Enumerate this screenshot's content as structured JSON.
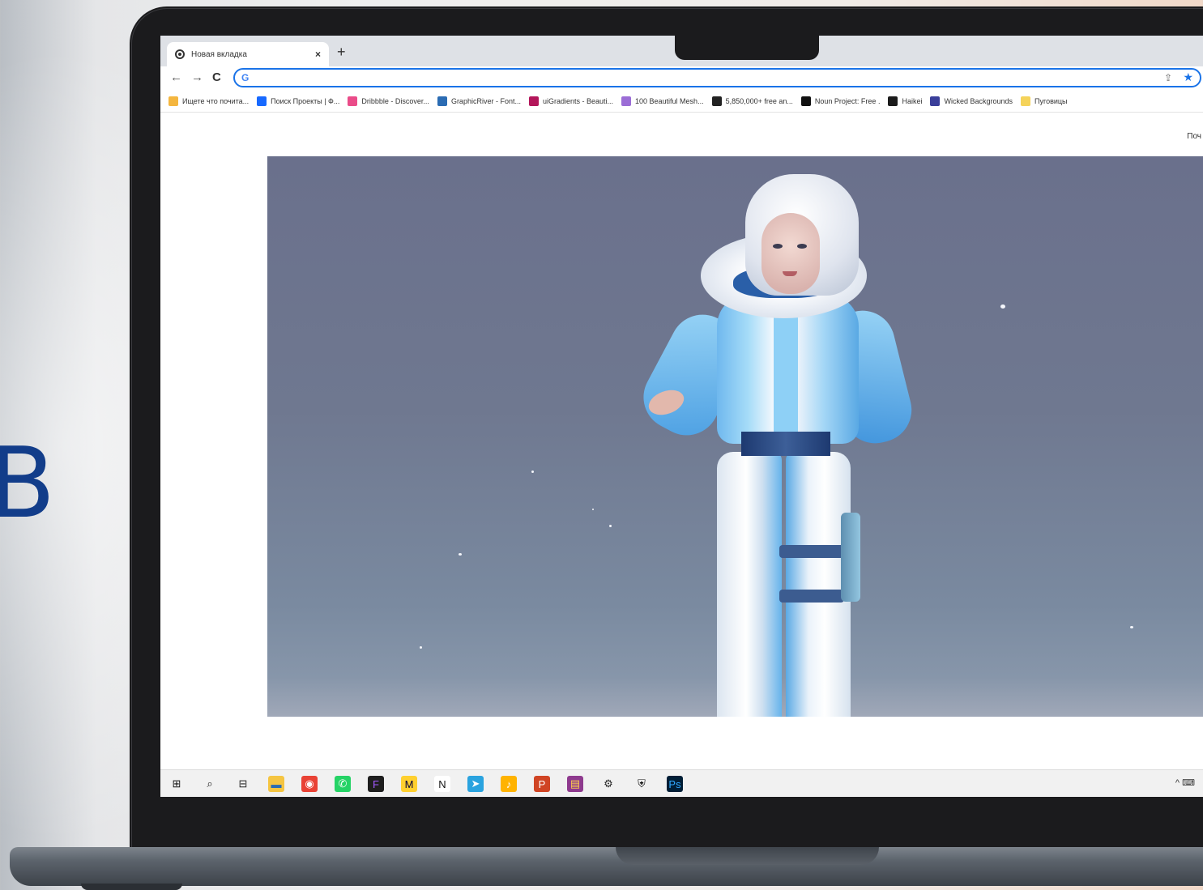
{
  "side_text": "В",
  "browser": {
    "tab": {
      "title": "Новая вкладка",
      "close": "×"
    },
    "new_tab": "+",
    "nav": {
      "back": "←",
      "forward": "→",
      "reload": "C"
    },
    "omnibox": {
      "value": "",
      "icon": "G"
    },
    "icons": {
      "share": "⇪",
      "bookmark": "★"
    },
    "bookmarks": [
      {
        "label": "Ищете что почита...",
        "color": "#f4b63f"
      },
      {
        "label": "Поиск Проекты | Ф...",
        "color": "#1769ff"
      },
      {
        "label": "Dribbble - Discover...",
        "color": "#ea4c89"
      },
      {
        "label": "GraphicRiver - Font...",
        "color": "#2b6cb3"
      },
      {
        "label": "uiGradients - Beauti...",
        "color": "#b3165a"
      },
      {
        "label": "100 Beautiful Mesh...",
        "color": "#9b6dd6"
      },
      {
        "label": "5,850,000+ free an...",
        "color": "#222222"
      },
      {
        "label": "Noun Project: Free .",
        "color": "#111111"
      },
      {
        "label": "Haikei",
        "color": "#1b1b1b"
      },
      {
        "label": "Wicked Backgrounds",
        "color": "#3a3f9a"
      },
      {
        "label": "Пуговицы",
        "color": "#f5d35a"
      }
    ],
    "page_link": "Поч"
  },
  "taskbar": {
    "icons": [
      {
        "name": "windows-start-icon",
        "glyph": "⊞",
        "bg": "transparent",
        "fg": "#111"
      },
      {
        "name": "search-icon",
        "glyph": "⌕",
        "bg": "transparent",
        "fg": "#222"
      },
      {
        "name": "task-view-icon",
        "glyph": "⊟",
        "bg": "transparent",
        "fg": "#222"
      },
      {
        "name": "file-explorer-icon",
        "glyph": "▬",
        "bg": "#f5c542",
        "fg": "#2b6cb3"
      },
      {
        "name": "chrome-icon",
        "glyph": "◉",
        "bg": "#e94235",
        "fg": "#fff"
      },
      {
        "name": "whatsapp-icon",
        "glyph": "✆",
        "bg": "#25d366",
        "fg": "#fff"
      },
      {
        "name": "figma-icon",
        "glyph": "F",
        "bg": "#1e1e1e",
        "fg": "#a259ff"
      },
      {
        "name": "miro-icon",
        "glyph": "M",
        "bg": "#ffd02f",
        "fg": "#050038"
      },
      {
        "name": "notion-icon",
        "glyph": "N",
        "bg": "#ffffff",
        "fg": "#111"
      },
      {
        "name": "telegram-icon",
        "glyph": "➤",
        "bg": "#2aa3df",
        "fg": "#fff"
      },
      {
        "name": "music-icon",
        "glyph": "♪",
        "bg": "#ffb300",
        "fg": "#fff"
      },
      {
        "name": "powerpoint-icon",
        "glyph": "P",
        "bg": "#d04423",
        "fg": "#fff"
      },
      {
        "name": "winrar-icon",
        "glyph": "▤",
        "bg": "#8e3a8e",
        "fg": "#ffd24a"
      },
      {
        "name": "settings-gear-icon",
        "glyph": "⚙",
        "bg": "transparent",
        "fg": "#222"
      },
      {
        "name": "shield-icon",
        "glyph": "⛨",
        "bg": "transparent",
        "fg": "#111"
      },
      {
        "name": "photoshop-icon",
        "glyph": "Ps",
        "bg": "#001e36",
        "fg": "#31a8ff"
      }
    ],
    "tray": "^ ⌨"
  }
}
